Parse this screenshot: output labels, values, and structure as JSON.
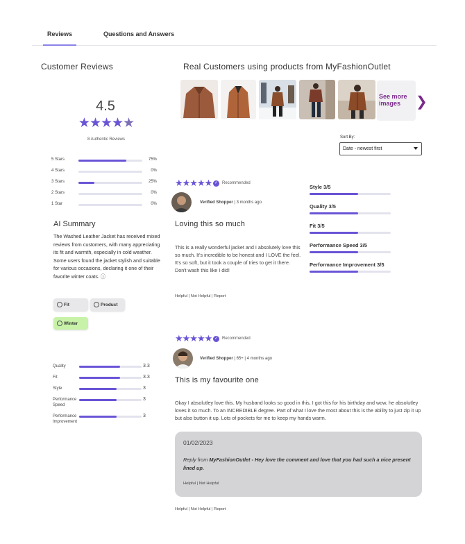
{
  "tabs": [
    {
      "label": "Reviews",
      "active": true
    },
    {
      "label": "Questions and Answers",
      "active": false
    }
  ],
  "summary": {
    "heading": "Customer Reviews",
    "rating": "4.5",
    "stars_value": 4.5,
    "authentic": "8 Authentic Reviews",
    "distribution": [
      {
        "label": "5 Stars",
        "pct": "75%",
        "fraction": 0.75
      },
      {
        "label": "4 Stars",
        "pct": "0%",
        "fraction": 0
      },
      {
        "label": "3 Stars",
        "pct": "25%",
        "fraction": 0.25
      },
      {
        "label": "2 Stars",
        "pct": "0%",
        "fraction": 0
      },
      {
        "label": "1 Star",
        "pct": "0%",
        "fraction": 0
      }
    ]
  },
  "ai_summary": {
    "title": "AI Summary",
    "text": "The Washed Leather Jacket has received mixed reviews from customers, with many appreciating its fit and warmth, especially in cold weather. Some users found the jacket stylish and suitable for various occasions, declaring it one of their favorite winter coats. ⓘ",
    "chips": [
      {
        "label": "Fit"
      },
      {
        "label": "Product"
      },
      {
        "label": "Winter",
        "selected": true
      }
    ]
  },
  "attributes": [
    {
      "label": "Quality",
      "value": "3.3",
      "fraction": 0.66
    },
    {
      "label": "Fit",
      "value": "3.3",
      "fraction": 0.66
    },
    {
      "label": "Style",
      "value": "3",
      "fraction": 0.6
    },
    {
      "label": "Performance Speed",
      "value": "3",
      "fraction": 0.6
    },
    {
      "label": "Performance Improvement",
      "value": "3",
      "fraction": 0.6
    }
  ],
  "gallery": {
    "heading": "Real Customers using products from MyFashionOutlet",
    "see_more": "See more images",
    "next_icon": "chevron-right-icon"
  },
  "sort": {
    "label": "Sort By:",
    "selected": "Date - newest first"
  },
  "reviews": [
    {
      "stars": "★★★★★",
      "recommended": "Recommended",
      "shopper_label": "Verified Shopper",
      "shopper_meta": " | 3 months ago",
      "title": "Loving this so much",
      "body": "This is a really wonderful jacket and I absolutely love this so much. It's incredible to be honest and I LOVE the feel. It's so soft, but it took a couple of tries to get it there. Don't wash this like I did!",
      "actions": "Helpful | Not Helpful | Report"
    },
    {
      "stars": "★★★★★",
      "recommended": "Recommended",
      "shopper_label": "Verified Shopper",
      "shopper_meta": " | 65+ | 4 months ago",
      "title": "This is my favourite one",
      "body": "Okay I absolutley love this. My husband looks so good in this, I got this for his birthday and wow, he absolutley loves it so much. To an INCREDIBLE degree. Part of what I love the most about this is the ability to just zip it up but also button it up. Lots of pockets for me to keep my hands warm.",
      "actions": "Helpful | Not Helpful | Report",
      "reply": {
        "date": "01/02/2023",
        "prefix": "Reply from ",
        "author": "MyFashionOutlet",
        "text": " - Hey love the comment and love that you had such a nice present lined up.",
        "actions": "Helpful | Not Helpful"
      }
    }
  ],
  "review_metrics": [
    {
      "label": "Style 3/5",
      "fraction": 0.6
    },
    {
      "label": "Quality 3/5",
      "fraction": 0.6
    },
    {
      "label": "Fit 3/5",
      "fraction": 0.6
    },
    {
      "label": "Performance Speed 3/5",
      "fraction": 0.6
    },
    {
      "label": "Performance Improvement 3/5",
      "fraction": 0.6
    }
  ],
  "colors": {
    "accent": "#6a54d6",
    "track": "#e3e3ee",
    "see_more": "#7a2a8a",
    "chip_selected": "#c7f2a8",
    "reply_bg": "#d4d4d6"
  }
}
